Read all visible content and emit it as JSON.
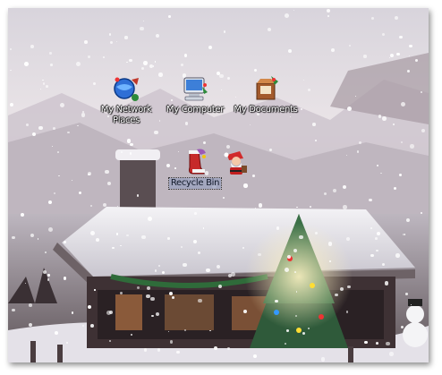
{
  "desktop": {
    "icons": [
      {
        "label": "My Network Places",
        "icon": "network-places-icon"
      },
      {
        "label": "My Computer",
        "icon": "computer-icon"
      },
      {
        "label": "My Documents",
        "icon": "documents-icon"
      },
      {
        "label": "Recycle Bin",
        "icon": "recycle-bin-icon",
        "selected": true
      },
      {
        "label": "",
        "icon": "santa-icon"
      }
    ]
  },
  "colors": {
    "selection": "#9aa3c0",
    "label_text": "#ffffff"
  }
}
